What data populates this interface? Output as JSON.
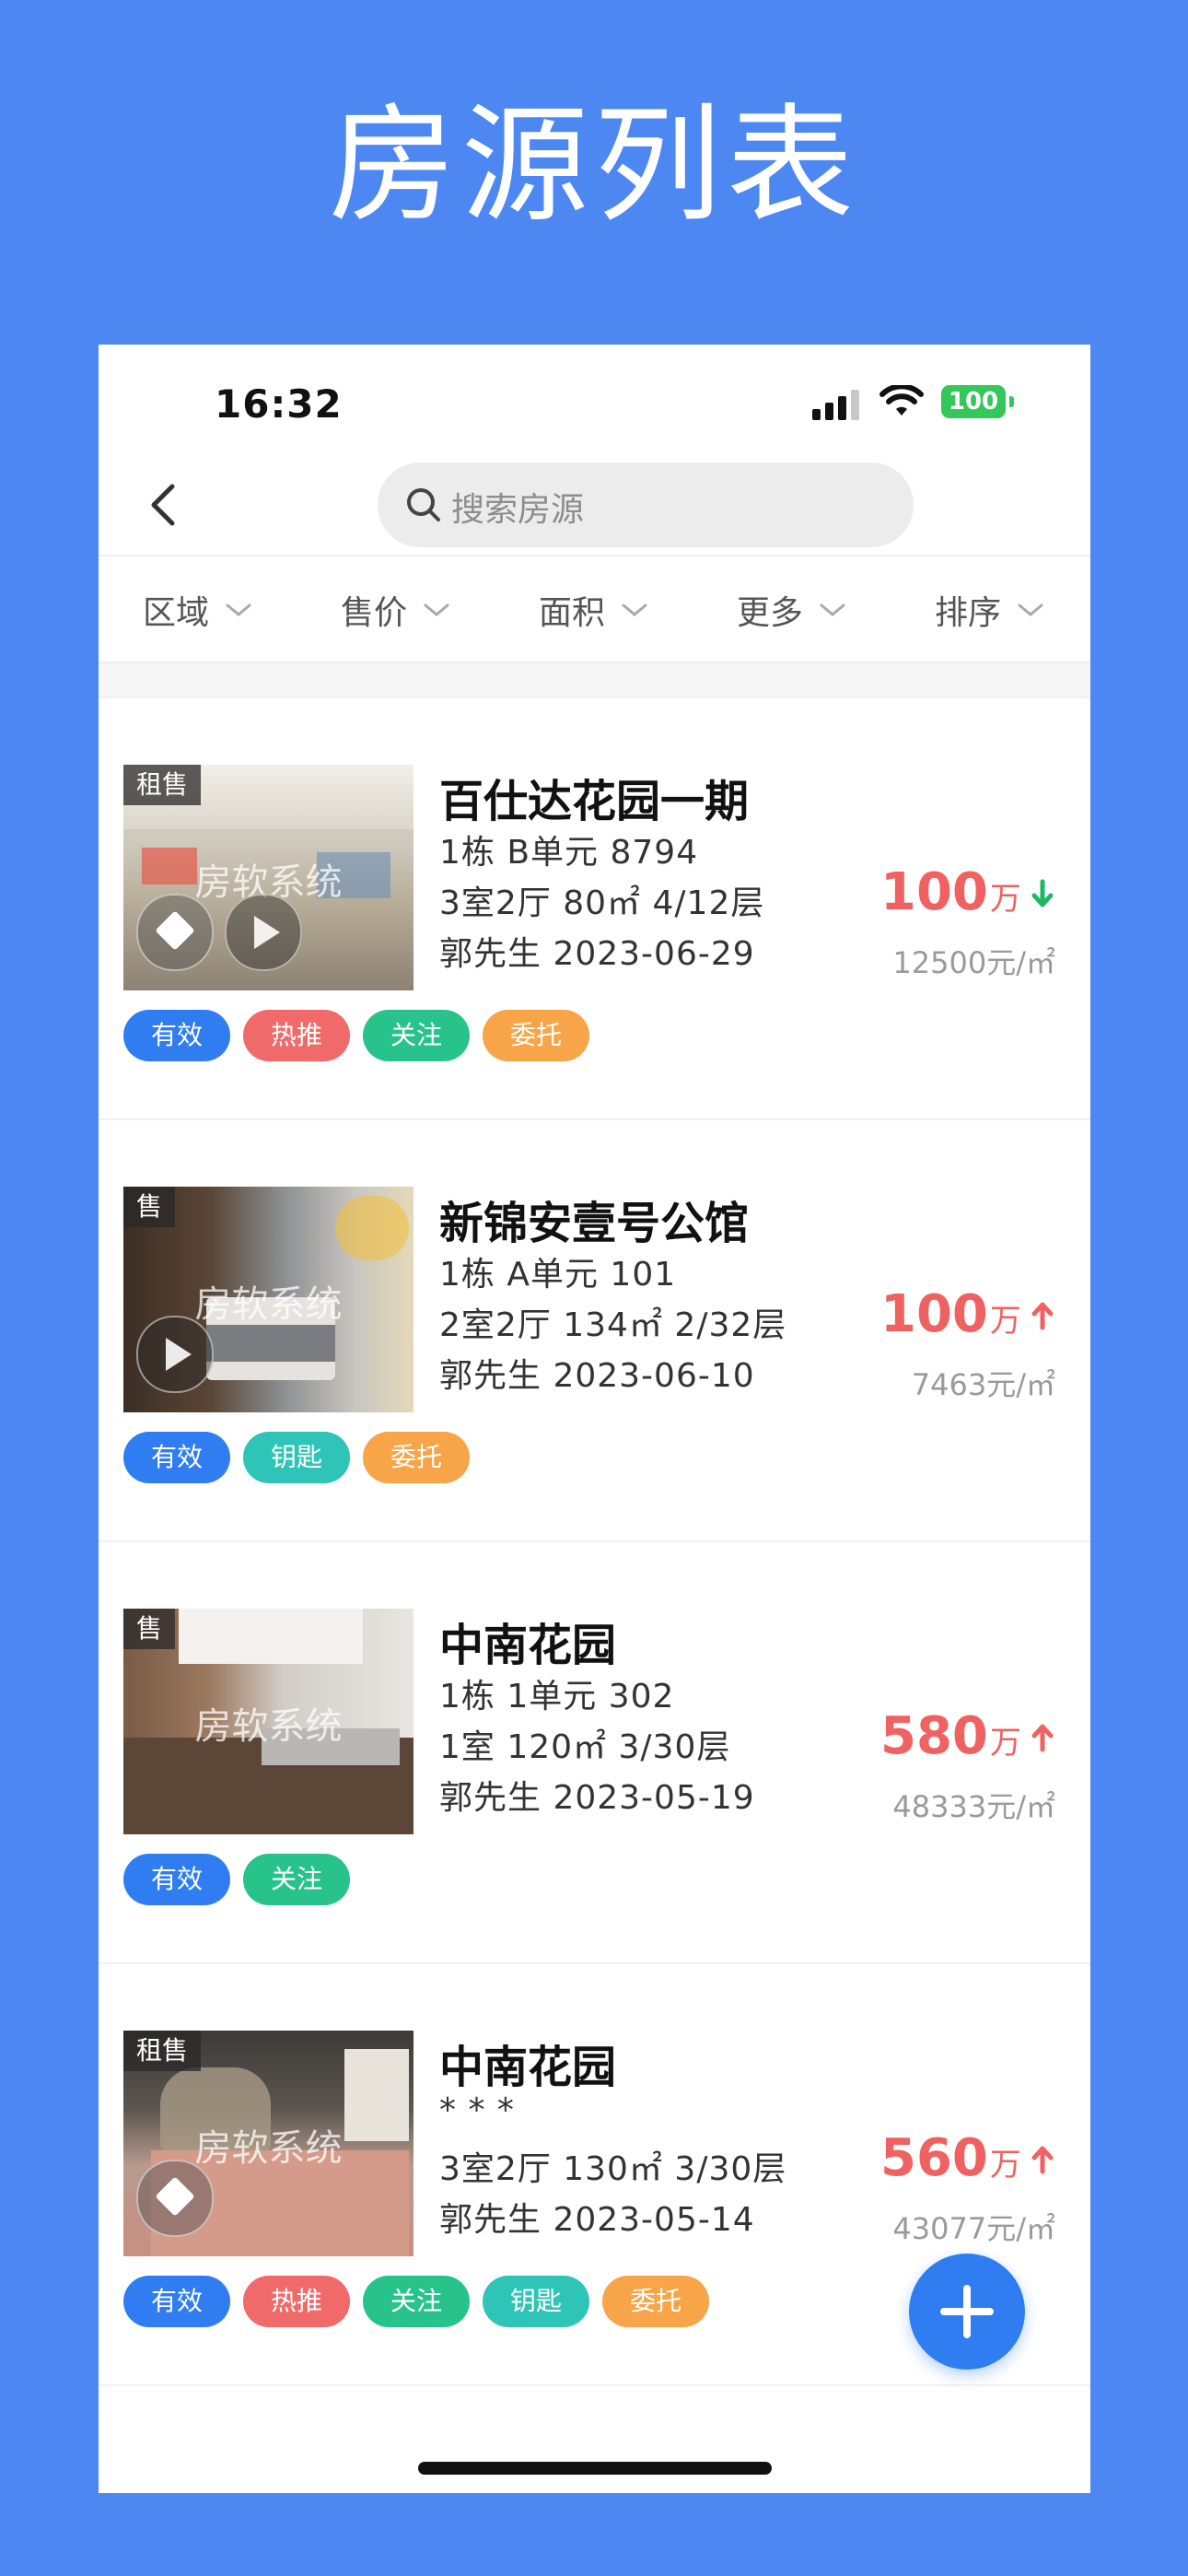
{
  "hero": {
    "title": "房源列表"
  },
  "status_bar": {
    "time": "16:32",
    "battery": "100"
  },
  "search": {
    "placeholder": "搜索房源"
  },
  "filters": [
    {
      "label": "区域"
    },
    {
      "label": "售价"
    },
    {
      "label": "面积"
    },
    {
      "label": "更多"
    },
    {
      "label": "排序"
    }
  ],
  "colors": {
    "accent": "#2f7df0",
    "price": "#f06262",
    "trend_down": "#1db866",
    "tag_valid": "#2f7df0",
    "tag_hot": "#f06a6a",
    "tag_follow": "#27c38a",
    "tag_key": "#2fc4b8",
    "tag_entrust": "#f7a548"
  },
  "listings": [
    {
      "badge": "租售",
      "watermark": "房软系统",
      "title": "百仕达花园一期",
      "line1": "1栋  B单元  8794",
      "line2": "3室2厅  80㎡  4/12层",
      "line3": "郭先生  2023-06-29",
      "price": "100",
      "price_unit": "万",
      "trend": "down",
      "unit_price": "12500元/㎡",
      "tags": [
        "有效",
        "热推",
        "关注",
        "委托"
      ]
    },
    {
      "badge": "售",
      "watermark": "房软系统",
      "title": "新锦安壹号公馆",
      "line1": "1栋  A单元  101",
      "line2": "2室2厅  134㎡  2/32层",
      "line3": "郭先生  2023-06-10",
      "price": "100",
      "price_unit": "万",
      "trend": "up",
      "unit_price": "7463元/㎡",
      "tags": [
        "有效",
        "钥匙",
        "委托"
      ]
    },
    {
      "badge": "售",
      "watermark": "房软系统",
      "title": "中南花园",
      "line1": "1栋  1单元  302",
      "line2": "1室  120㎡  3/30层",
      "line3": "郭先生  2023-05-19",
      "price": "580",
      "price_unit": "万",
      "trend": "up",
      "unit_price": "48333元/㎡",
      "tags": [
        "有效",
        "关注"
      ]
    },
    {
      "badge": "租售",
      "watermark": "房软系统",
      "title": "中南花园",
      "line1": "* * *",
      "line2": "3室2厅  130㎡  3/30层",
      "line3": "郭先生  2023-05-14",
      "price": "560",
      "price_unit": "万",
      "trend": "up",
      "unit_price": "43077元/㎡",
      "tags": [
        "有效",
        "热推",
        "关注",
        "钥匙",
        "委托"
      ]
    }
  ],
  "fab": {
    "icon": "plus-icon"
  }
}
